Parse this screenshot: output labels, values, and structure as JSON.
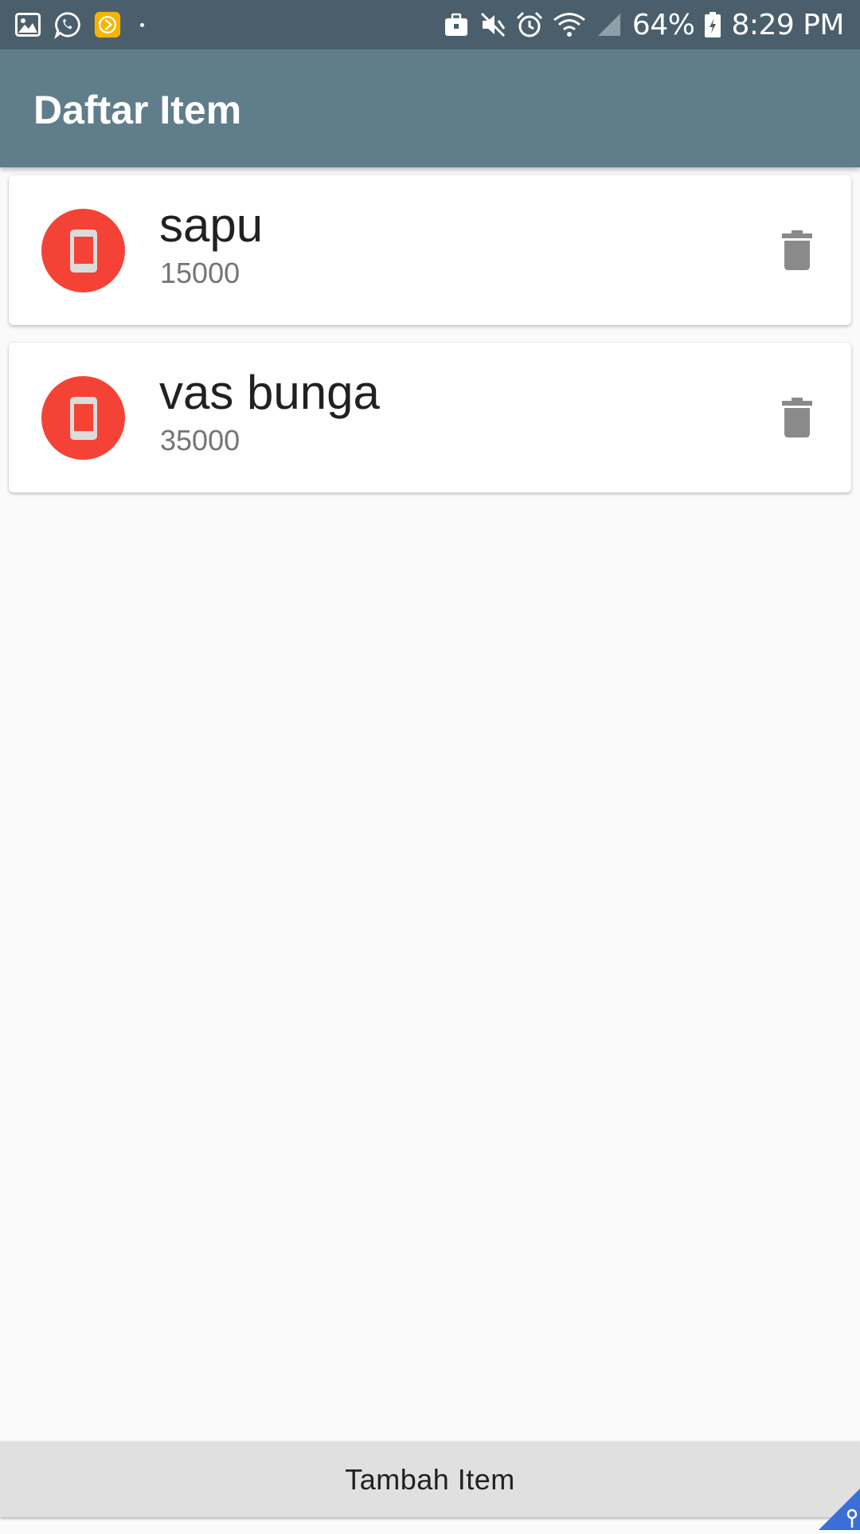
{
  "status_bar": {
    "battery_percent": "64%",
    "time": "8:29 PM",
    "left_icons": [
      "gallery-icon",
      "whatsapp-icon",
      "app-notification-icon"
    ],
    "right_icons": [
      "briefcase-icon",
      "mute-icon",
      "alarm-icon",
      "wifi-icon",
      "signal-icon",
      "battery-icon"
    ]
  },
  "app_bar": {
    "title": "Daftar Item"
  },
  "items": [
    {
      "name": "sapu",
      "price": "15000"
    },
    {
      "name": "vas bunga",
      "price": "35000"
    }
  ],
  "actions": {
    "add_label": "Tambah Item"
  },
  "colors": {
    "status_bar": "#4a5f6b",
    "app_bar": "#607d8b",
    "avatar": "#f44336",
    "delete_icon": "#8a8a8a",
    "bottom_button": "#e0e0e0",
    "background": "#fafafa"
  }
}
